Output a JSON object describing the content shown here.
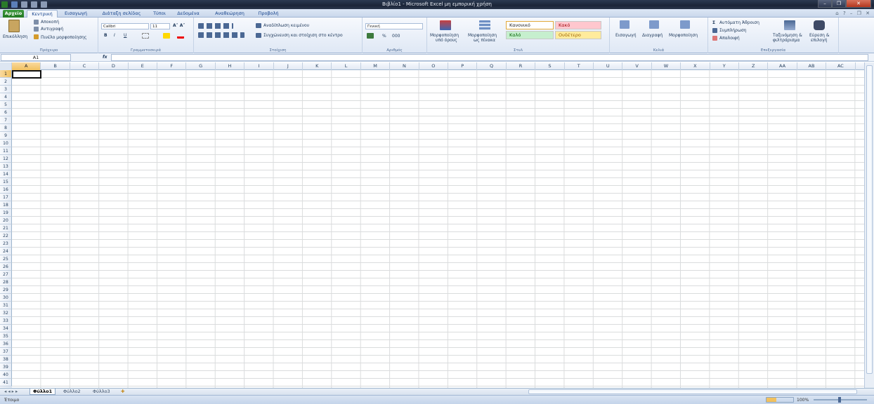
{
  "window": {
    "title": "Βιβλίο1 - Microsoft Excel μη εμπορική χρήση"
  },
  "tabs": [
    "Αρχείο",
    "Κεντρική",
    "Εισαγωγή",
    "Διάταξη σελίδας",
    "Τύποι",
    "Δεδομένα",
    "Αναθεώρηση",
    "Προβολή"
  ],
  "ribbon": {
    "clipboard": {
      "paste": "Επικόλληση",
      "cut": "Αποκοπή",
      "copy": "Αντιγραφή",
      "painter": "Πινέλο μορφοποίησης",
      "label": "Πρόχειρο"
    },
    "font": {
      "name": "Calibri",
      "size": "11",
      "label": "Γραμματοσειρά"
    },
    "alignment": {
      "wrap": "Αναδίπλωση κειμένου",
      "merge": "Συγχώνευση και στοίχιση στο κέντρο",
      "label": "Στοίχιση"
    },
    "number": {
      "format": "Γενική",
      "label": "Αριθμός",
      "percent": "%",
      "thousands": "000"
    },
    "styles": {
      "cond1": "Μορφοποίηση",
      "cond2": "υπό όρους",
      "table1": "Μορφοποίηση",
      "table2": "ως πίνακα",
      "normal": "Κανονικό",
      "bad": "Κακό",
      "good": "Καλό",
      "neutral": "Ουδέτερο",
      "label": "Στυλ"
    },
    "cells": {
      "insert": "Εισαγωγή",
      "delete": "Διαγραφή",
      "format": "Μορφοποίηση",
      "label": "Κελιά"
    },
    "editing": {
      "autosum": "Αυτόματη Άθροιση",
      "fill": "Συμπλήρωση",
      "clear": "Απαλοιφή",
      "sort1": "Ταξινόμηση &",
      "sort2": "φιλτράρισμα",
      "find1": "Εύρεση &",
      "find2": "επιλογή",
      "label": "Επεξεργασία"
    }
  },
  "formula_bar": {
    "name_box": "A1",
    "fx": "fx",
    "value": ""
  },
  "columns": [
    "A",
    "B",
    "C",
    "D",
    "E",
    "F",
    "G",
    "H",
    "I",
    "J",
    "K",
    "L",
    "M",
    "N",
    "O",
    "P",
    "Q",
    "R",
    "S",
    "T",
    "U",
    "V",
    "W",
    "X",
    "Y",
    "Z",
    "AA",
    "AB",
    "AC"
  ],
  "rows": [
    "1",
    "2",
    "3",
    "4",
    "5",
    "6",
    "7",
    "8",
    "9",
    "10",
    "11",
    "12",
    "13",
    "14",
    "15",
    "16",
    "17",
    "18",
    "19",
    "20",
    "21",
    "22",
    "23",
    "24",
    "25",
    "26",
    "27",
    "28",
    "29",
    "30",
    "31",
    "32",
    "33",
    "34",
    "35",
    "36",
    "37",
    "38",
    "39",
    "40",
    "41"
  ],
  "sheets": [
    "Φύλλο1",
    "Φύλλο2",
    "Φύλλο3"
  ],
  "status": {
    "ready": "Έτοιμο",
    "zoom": "100%"
  },
  "colors": {
    "accent": "#15428b",
    "file_tab": "#217821",
    "bad": "#ffc7ce",
    "good": "#c6efce",
    "neutral": "#ffeb9c"
  }
}
